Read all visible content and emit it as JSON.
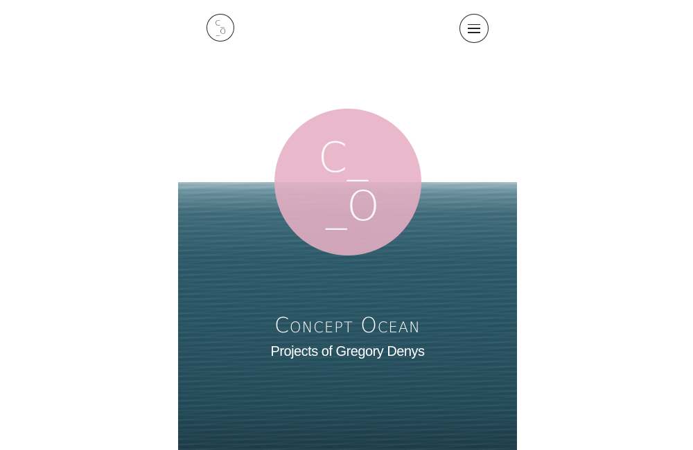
{
  "header": {
    "logo_line1": "C_",
    "logo_line2": "_O",
    "menu_icon": "hamburger-menu-icon"
  },
  "hero": {
    "logo_line1": "C_",
    "logo_line2": "_O",
    "title": "Concept Ocean",
    "subtitle": "Projects of Gregory Denys"
  },
  "colors": {
    "logo_circle": "#e6afc4",
    "ocean": "#2f5e6e",
    "text_light": "#ffffff",
    "outline": "#222222"
  }
}
